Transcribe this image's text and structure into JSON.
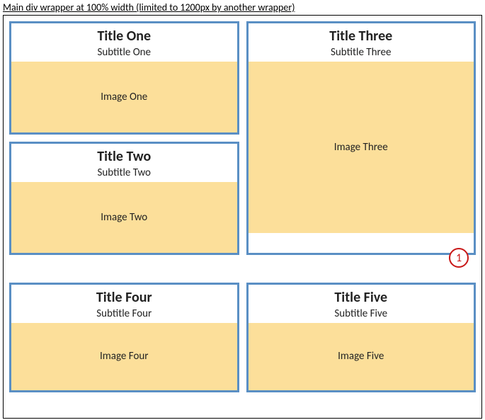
{
  "caption": "Main div wrapper at 100% width (limited to 1200px by another wrapper)",
  "cards": {
    "one": {
      "title": "Title One",
      "subtitle": "Subtitle One",
      "image": "Image One"
    },
    "two": {
      "title": "Title Two",
      "subtitle": "Subtitle Two",
      "image": "Image Two"
    },
    "three": {
      "title": "Title Three",
      "subtitle": "Subtitle Three",
      "image": "Image Three"
    },
    "four": {
      "title": "Title Four",
      "subtitle": "Subtitle Four",
      "image": "Image Four"
    },
    "five": {
      "title": "Title Five",
      "subtitle": "Subtitle Five",
      "image": "Image Five"
    }
  },
  "annotation": "1",
  "colors": {
    "border": "#5a8fc4",
    "image_bg": "#fcdf9a",
    "annotation": "#c91818"
  }
}
